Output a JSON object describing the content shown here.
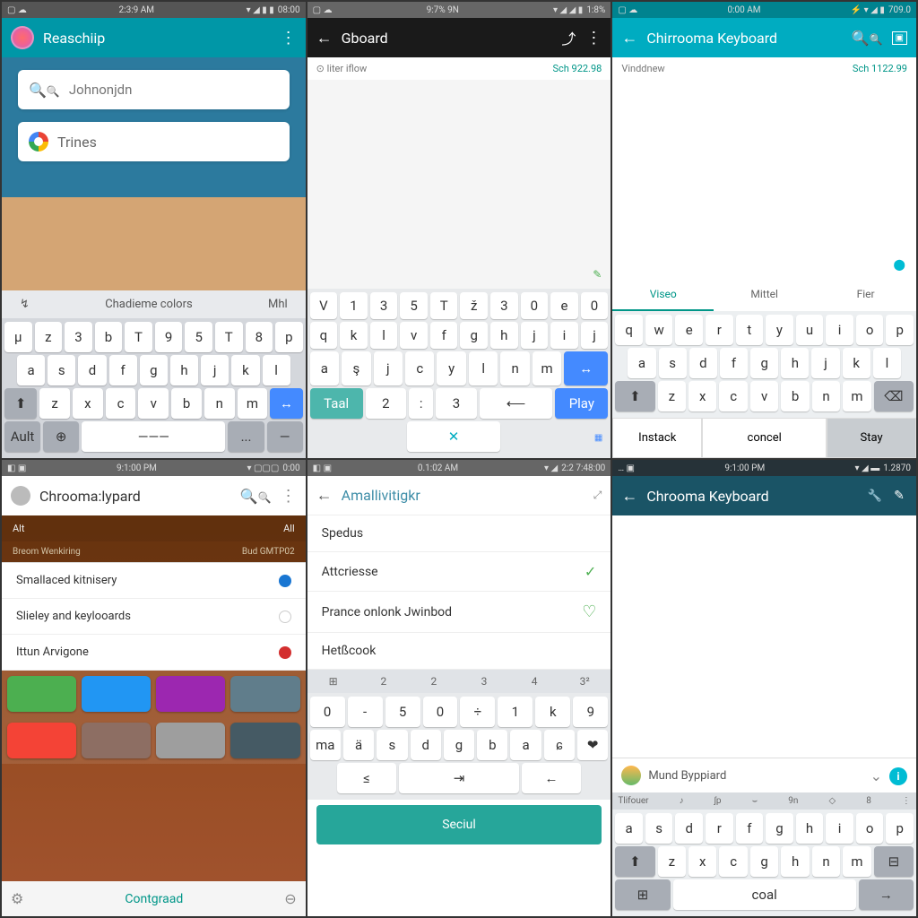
{
  "p1": {
    "status": {
      "time": "2:3:9 AM",
      "batt": "08:00"
    },
    "title": "Reaschiip",
    "search_ph": "Johnonjdn",
    "suggest2": "Trines",
    "sug_left": "↯",
    "sug_mid": "Chadieme colors",
    "sug_right": "Mhl",
    "r1": [
      "µ",
      "z",
      "3",
      "b",
      "T",
      "9",
      "5",
      "T",
      "8",
      "p"
    ],
    "r2": [
      "a",
      "s",
      "d",
      "f",
      "g",
      "h",
      "j",
      "k",
      "l"
    ],
    "r3_shift": "⬆",
    "r3": [
      "z",
      "x",
      "c",
      "v",
      "b",
      "n",
      "m"
    ],
    "r3_act": "↔",
    "r4": [
      "Ault",
      "⊕",
      "———",
      "...",
      "—"
    ]
  },
  "p2": {
    "status": {
      "time": "9:7% 9N",
      "batt": "1:8%"
    },
    "title": "Gboard",
    "meta_l": "⊙ liter iflow",
    "meta_r": "Sch 922.98",
    "r1": [
      "V",
      "1",
      "3",
      "5",
      "T",
      "ž",
      "3",
      "0",
      "e",
      "0"
    ],
    "r2": [
      "q",
      "k",
      "l",
      "v",
      "f",
      "g",
      "h",
      "j",
      "i",
      "j"
    ],
    "r3": [
      "a",
      "ş",
      "j",
      "c",
      "y",
      "l",
      "n",
      "m"
    ],
    "r3_act": "↔",
    "r4": [
      "Taal",
      "2",
      ":",
      "3",
      "⟵",
      "Play"
    ],
    "r5": "✕"
  },
  "p3": {
    "status": {
      "time": "0:00 AM",
      "batt": "709.0"
    },
    "title": "Chirrooma Keyboard",
    "meta_l": "Vinddnew",
    "meta_r": "Sch 1122.99",
    "tabs": [
      "Viseo",
      "Mittel",
      "Fier"
    ],
    "r1": [
      "q",
      "w",
      "e",
      "r",
      "t",
      "y",
      "u",
      "i",
      "o",
      "p"
    ],
    "r2": [
      "a",
      "s",
      "d",
      "f",
      "g",
      "h",
      "j",
      "k",
      "l"
    ],
    "r3_shift": "⬆",
    "r3": [
      "z",
      "x",
      "c",
      "v",
      "b",
      "n",
      "m"
    ],
    "r3_del": "⌫",
    "btns": [
      "Instack",
      "concel",
      "Stay"
    ]
  },
  "p4": {
    "status": {
      "time": "9:1:00 PM",
      "batt": "0:00"
    },
    "title": "Chrooma:lypard",
    "tags": [
      "Alt",
      "All"
    ],
    "sub": [
      "Breom Wenkiring",
      "Bud GMTP02"
    ],
    "items": [
      {
        "t": "Smallaced kitnisery",
        "d": "blue"
      },
      {
        "t": "Slieley and keylooards",
        "d": "white"
      },
      {
        "t": "Ittun Arvigone",
        "d": "red"
      }
    ],
    "theme_colors": [
      "#4caf50",
      "#2196f3",
      "#9c27b0",
      "#607d8b",
      "#f44336",
      "#8d6e63",
      "#9e9e9e",
      "#455a64"
    ],
    "bottom": "Contgraad"
  },
  "p5": {
    "status": {
      "time": "0.1:02 AM",
      "batt": "2:2 7:48:00"
    },
    "title": "Amallivitigkr",
    "items": [
      "Spedus",
      "Attcriesse",
      "Prance onlonk Jwinbod",
      "Hetßcook"
    ],
    "sug": [
      "⊞",
      "2",
      "2",
      "3",
      "4",
      "3²"
    ],
    "r1": [
      "0",
      "-",
      "5",
      "0",
      "÷",
      "1",
      "k",
      "9"
    ],
    "r2": [
      "ma",
      "ä",
      "s",
      "d",
      "g",
      "b",
      "a",
      "ɕ",
      "❤"
    ],
    "r3": [
      "≤",
      "⇥",
      "←"
    ],
    "btn": "Seciul"
  },
  "p6": {
    "status": {
      "time": "9:1:00 PM",
      "batt": "1.2870"
    },
    "title": "Chrooma Keyboard",
    "msg": "Mund Byppiard",
    "tool": [
      "Tlifouer",
      "♪",
      "ʃp",
      "⌣",
      "9n",
      "◇",
      "8",
      "⋮"
    ],
    "r1": [
      "a",
      "s",
      "d",
      "r",
      "f",
      "g",
      "h",
      "i",
      "o",
      "p"
    ],
    "r2_shift": "⬆",
    "r2": [
      "z",
      "x",
      "c",
      "g",
      "h",
      "n",
      "m"
    ],
    "r2_del": "⊟",
    "r3": [
      "⊞",
      "coal",
      "→"
    ]
  }
}
